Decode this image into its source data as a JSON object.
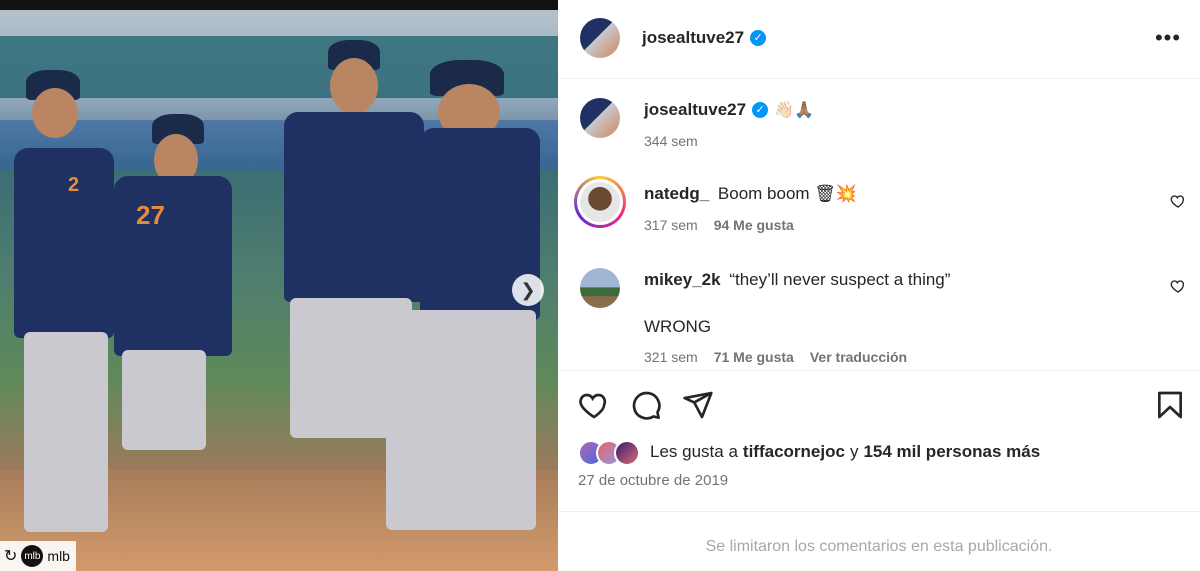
{
  "photo": {
    "credit": {
      "name": "mlb",
      "avatar_text": "mlb"
    },
    "next_icon": "chevron-right-icon",
    "jersey_numbers": [
      "2",
      "27"
    ]
  },
  "header": {
    "username": "josealtuve27",
    "verified": true,
    "more_icon": "more-horizontal-icon"
  },
  "caption": {
    "username": "josealtuve27",
    "text": "👋🏻🙏🏽",
    "time": "344 sem"
  },
  "comments": [
    {
      "username": "natedg_",
      "text": "Boom boom 🗑💥",
      "time": "317 sem",
      "likes": "94 Me gusta",
      "translate": ""
    },
    {
      "username": "mikey_2k",
      "text": "“they’ll never suspect a thing”",
      "text2": "WRONG",
      "time": "321 sem",
      "likes": "71 Me gusta",
      "translate": "Ver traducción"
    }
  ],
  "actions": {
    "like_icon": "heart-icon",
    "comment_icon": "comment-icon",
    "share_icon": "send-icon",
    "save_icon": "bookmark-icon"
  },
  "likes": {
    "prefix": "Les gusta a",
    "user": "tiffacornejoc",
    "connector": "y",
    "rest": "154 mil personas más"
  },
  "date": "27 de octubre de 2019",
  "comments_limited": "Se limitaron los comentarios en esta publicación.",
  "colors": {
    "accent": "#0095f6",
    "text": "#262626",
    "muted": "#737373"
  }
}
